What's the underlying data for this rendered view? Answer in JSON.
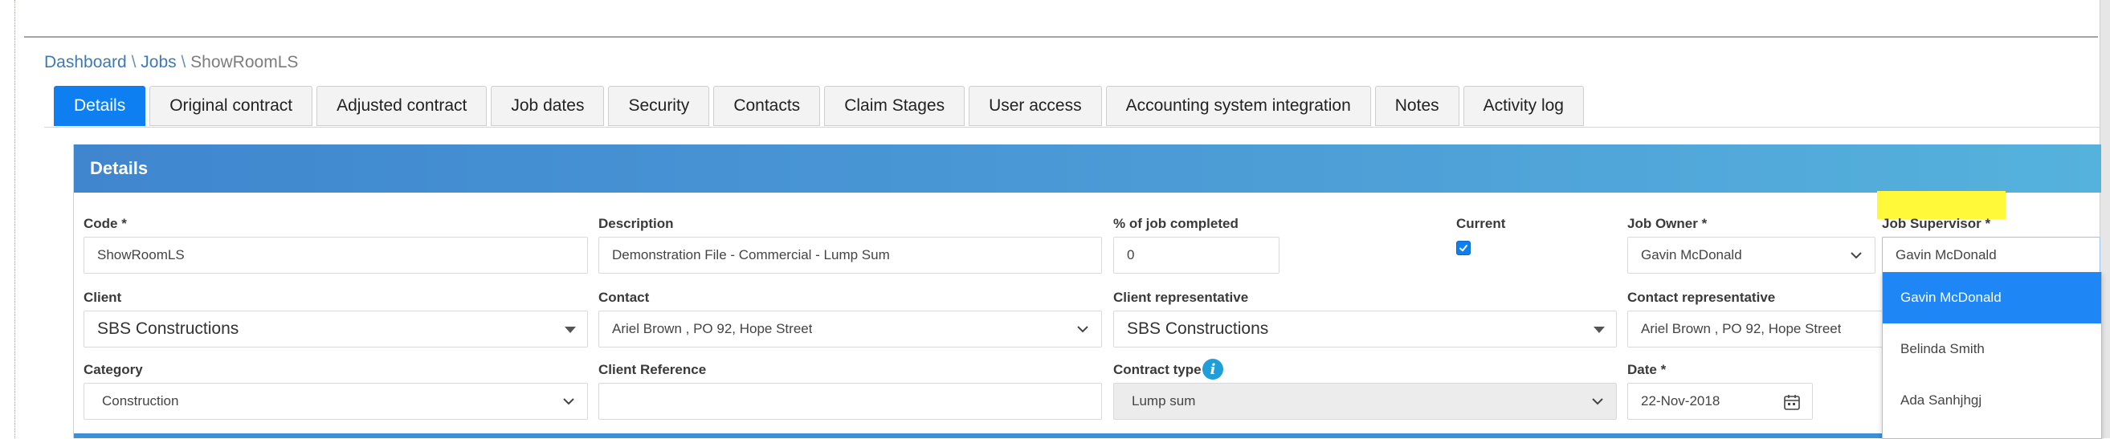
{
  "breadcrumb": {
    "items": [
      "Dashboard",
      "Jobs"
    ],
    "separator": "\\",
    "current": "ShowRoomLS"
  },
  "tabs": [
    {
      "label": "Details",
      "active": true
    },
    {
      "label": "Original contract"
    },
    {
      "label": "Adjusted contract"
    },
    {
      "label": "Job dates"
    },
    {
      "label": "Security"
    },
    {
      "label": "Contacts"
    },
    {
      "label": "Claim Stages"
    },
    {
      "label": "User access"
    },
    {
      "label": "Accounting system integration"
    },
    {
      "label": "Notes"
    },
    {
      "label": "Activity log"
    }
  ],
  "panel": {
    "title": "Details"
  },
  "form": {
    "code": {
      "label": "Code *",
      "value": "ShowRoomLS"
    },
    "description": {
      "label": "Description",
      "value": "Demonstration File - Commercial - Lump Sum"
    },
    "percent_completed": {
      "label": "% of job completed",
      "value": "0"
    },
    "current": {
      "label": "Current",
      "checked": true
    },
    "job_owner": {
      "label": "Job Owner *",
      "value": "Gavin McDonald"
    },
    "job_supervisor": {
      "label": "Job Supervisor *",
      "value": "Gavin McDonald"
    },
    "client": {
      "label": "Client",
      "value": "SBS Constructions"
    },
    "contact": {
      "label": "Contact",
      "value": "Ariel Brown , PO 92, Hope Street"
    },
    "client_representative": {
      "label": "Client representative",
      "value": "SBS Constructions"
    },
    "contact_representative": {
      "label": "Contact representative",
      "value": "Ariel Brown , PO 92, Hope Street"
    },
    "category": {
      "label": "Category",
      "value": "Construction"
    },
    "client_reference": {
      "label": "Client Reference",
      "value": ""
    },
    "contract_type": {
      "label": "Contract type",
      "value": "Lump sum"
    },
    "date": {
      "label": "Date *",
      "value": "22-Nov-2018"
    }
  },
  "supervisor_dropdown": {
    "options": [
      "Gavin McDonald",
      "Belinda Smith",
      "Ada Sanhjhgj"
    ],
    "selected_index": 0
  },
  "colors": {
    "accent": "#0d7ff1",
    "panel_header_start": "#3f86cf",
    "panel_header_end": "#55b2dc",
    "highlight": "#fff93a",
    "info": "#1f9ed9"
  },
  "icons": {
    "checkbox": "check-icon",
    "dropdown": "chevron-down-icon",
    "select_caret": "caret-down-icon",
    "date": "calendar-icon",
    "info": "info-icon"
  }
}
